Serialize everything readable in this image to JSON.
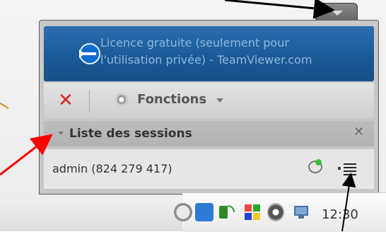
{
  "banner": {
    "line1": "Licence gratuite (seulement pour",
    "line2": "l'utilisation privée) - TeamViewer.com"
  },
  "toolbar": {
    "functions_label": "Fonctions"
  },
  "sessions": {
    "title": "Liste des sessions",
    "row_label": "admin (824 279 417)"
  },
  "taskbar": {
    "clock": "12:30"
  },
  "colors": {
    "banner_blue": "#1f63a6",
    "close_red": "#d22424",
    "annotation_red": "#ff0000"
  },
  "icons": [
    "collapse-chevron-icon",
    "teamviewer-logo-icon",
    "close-icon",
    "gear-icon",
    "dropdown-arrow-icon",
    "collapse-caret-icon",
    "remote-control-icon",
    "menu-icon",
    "tray-back-icon",
    "teamviewer-tray-icon",
    "network-signal-icon",
    "windows-flag-icon",
    "tray-disc-icon",
    "tray-monitor-icon"
  ]
}
